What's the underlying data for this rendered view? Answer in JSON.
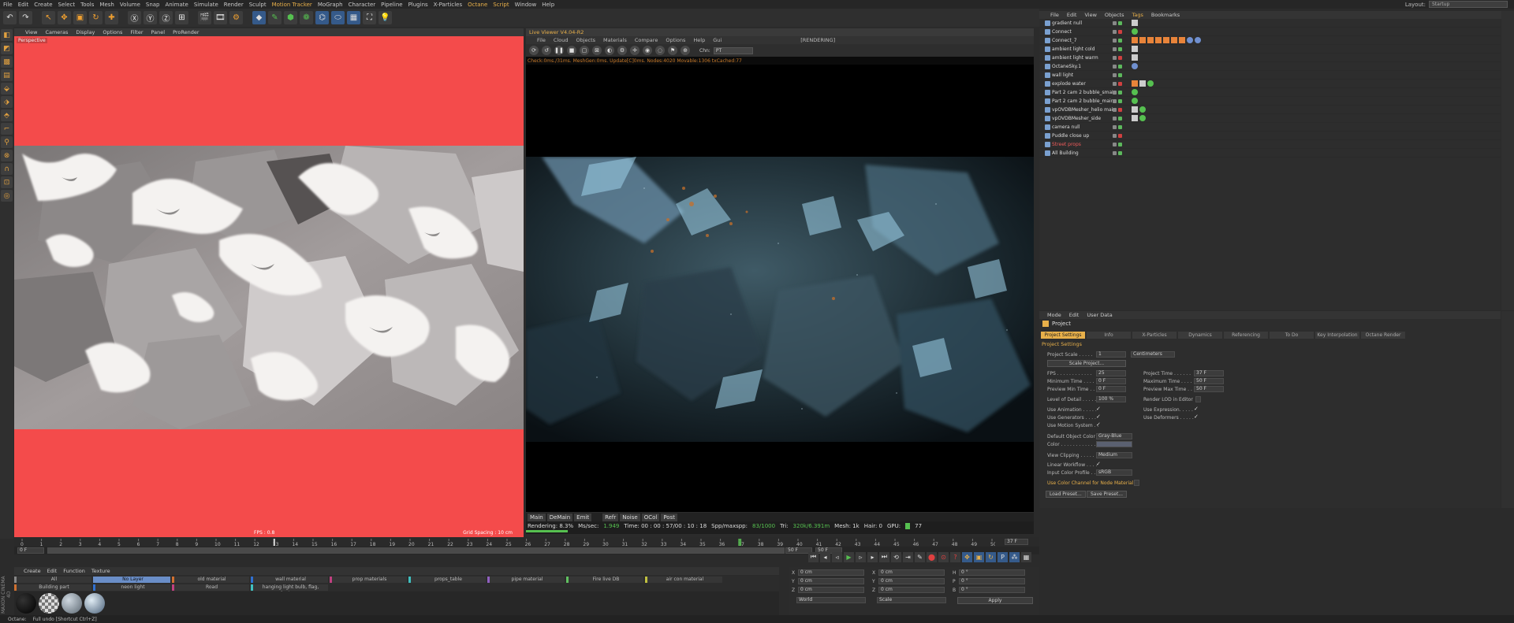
{
  "menubar": [
    "File",
    "Edit",
    "Create",
    "Select",
    "Tools",
    "Mesh",
    "Volume",
    "Snap",
    "Animate",
    "Simulate",
    "Render",
    "Sculpt",
    "Motion Tracker",
    "MoGraph",
    "Character",
    "Pipeline",
    "Plugins",
    "X-Particles",
    "Octane",
    "Script",
    "Window",
    "Help"
  ],
  "layout": {
    "label": "Layout:",
    "value": "Startup"
  },
  "viewport": {
    "menu": [
      "View",
      "Cameras",
      "Display",
      "Options",
      "Filter",
      "Panel",
      "ProRender"
    ],
    "label": "Perspective",
    "fps": "FPS : 0.8",
    "grid": "Grid Spacing : 10 cm"
  },
  "live_viewer": {
    "title": "Live Viewer V4.04-R2",
    "menu": [
      "File",
      "Cloud",
      "Objects",
      "Materials",
      "Compare",
      "Options",
      "Help",
      "Gui"
    ],
    "rendering_label": "[RENDERING]",
    "channel_label": "Chn:",
    "channel_value": "PT",
    "status": "Check:0ms./31ms. MeshGen:0ms. Update[C]0ms. Nodes:4020 Movable:1306 txCached:77",
    "tabs": [
      "Main",
      "DeMain",
      "Emit",
      "Refr",
      "Noise",
      "OCol",
      "Post"
    ],
    "stats": {
      "rendering": "Rendering: 8.3%",
      "ms_label": "Ms/sec:",
      "ms_value": "1.949",
      "time": "Time: 00 : 00 : 57/00 : 10 : 18",
      "spp_label": "Spp/maxspp:",
      "spp_value": "83/1000",
      "tri_label": "Tri:",
      "tri_value": "320k/6.391m",
      "mesh": "Mesh: 1k",
      "hair": "Hair: 0",
      "gpu_label": "GPU:",
      "gpu_value": "77"
    },
    "progress": 0.083
  },
  "object_manager": {
    "menu": [
      "File",
      "Edit",
      "View",
      "Objects",
      "Tags",
      "Bookmarks"
    ],
    "objects": [
      {
        "name": "gradient null",
        "red": false
      },
      {
        "name": "Connect",
        "red": false
      },
      {
        "name": "Connect_7",
        "red": false
      },
      {
        "name": "ambient light cold",
        "red": false
      },
      {
        "name": "ambient light warm",
        "red": false
      },
      {
        "name": "OctaneSky.1",
        "red": false
      },
      {
        "name": "wall light",
        "red": false
      },
      {
        "name": "explode water",
        "red": false
      },
      {
        "name": "Part 2 cam 2 bubble_small.2",
        "red": false
      },
      {
        "name": "Part 2 cam 2 bubble_main.2",
        "red": false
      },
      {
        "name": "vpOVDBMesher_helio main",
        "red": false
      },
      {
        "name": "vpOVDBMesher_side",
        "red": false
      },
      {
        "name": "camera null",
        "red": false
      },
      {
        "name": "Puddle close up",
        "red": false
      },
      {
        "name": "Street props",
        "red": true
      },
      {
        "name": "All Building",
        "red": false
      }
    ]
  },
  "attribute_manager": {
    "menu": [
      "Mode",
      "Edit",
      "User Data"
    ],
    "title": "Project",
    "tabs": [
      "Project Settings",
      "Info",
      "X-Particles",
      "Dynamics",
      "Referencing",
      "To Do",
      "Key Interpolation",
      "Octane Render"
    ],
    "section": "Project Settings",
    "project_scale_label": "Project Scale . . . . .",
    "project_scale_value": "1",
    "project_scale_unit": "Centimeters",
    "scale_project_button": "Scale Project...",
    "fps_label": "FPS . . . . . . . . . . . .",
    "fps_value": "25",
    "project_time_label": "Project Time . . . . . .",
    "project_time_value": "37 F",
    "min_time_label": "Minimum Time . . . .",
    "min_time_value": "0 F",
    "max_time_label": "Maximum Time . . . .",
    "max_time_value": "50 F",
    "prev_min_label": "Preview Min Time . .",
    "prev_min_value": "0 F",
    "prev_max_label": "Preview Max Time . .",
    "prev_max_value": "50 F",
    "lod_label": "Level of Detail . . . . .",
    "lod_value": "100 %",
    "render_lod_label": "Render LOD in Editor",
    "use_animation": "Use Animation . . . . .",
    "use_expression": "Use Expression. . . . .",
    "use_generators": "Use Generators . . . .",
    "use_deformers": "Use Deformers . . . . .",
    "use_motion": "Use Motion System . .",
    "default_color_label": "Default Object Color",
    "default_color_value": "Gray-Blue",
    "color_label": "Color . . . . . . . . . . . .",
    "view_clipping_label": "View Clipping . . . . .",
    "view_clipping_value": "Medium",
    "linear_label": "Linear Workflow . . . .",
    "input_color_label": "Input Color Profile . .",
    "input_color_value": "sRGB",
    "use_color_channel": "Use Color Channel for Node Material",
    "load_preset": "Load Preset...",
    "save_preset": "Save Preset...",
    "checkmark": "✓"
  },
  "timeline": {
    "frames": [
      "0",
      "1",
      "2",
      "3",
      "4",
      "5",
      "6",
      "7",
      "8",
      "9",
      "10",
      "11",
      "12",
      "13",
      "14",
      "15",
      "16",
      "17",
      "18",
      "19",
      "20",
      "21",
      "22",
      "23",
      "24",
      "25",
      "26",
      "27",
      "28",
      "29",
      "30",
      "31",
      "32",
      "33",
      "34",
      "35",
      "36",
      "37",
      "38",
      "39",
      "40",
      "41",
      "42",
      "43",
      "44",
      "45",
      "46",
      "47",
      "48",
      "49",
      "50"
    ],
    "current_frame": "37 F",
    "start_field": "0 F",
    "end_field_a": "50 F",
    "end_field_b": "50 F"
  },
  "material_manager": {
    "menu": [
      "Create",
      "Edit",
      "Function",
      "Texture"
    ],
    "layers_row1": [
      "All",
      "No Layer",
      "old material",
      "wall material",
      "prop materials",
      "props_table",
      "pipe material",
      "Fire live DB",
      "air con material"
    ],
    "layers_row2": [
      "Building part",
      "neon light",
      "Road",
      "hanging light bulb, flag, lanterns"
    ]
  },
  "coordinates": {
    "labels": [
      "X",
      "Y",
      "Z",
      "X",
      "Y",
      "Z",
      "H",
      "P",
      "B"
    ],
    "values": [
      "0 cm",
      "0 cm",
      "0 cm",
      "0 cm",
      "0 cm",
      "0 cm",
      "0 °",
      "0 °",
      "0 °"
    ],
    "world": "World",
    "scale": "Scale",
    "apply": "Apply"
  },
  "status": {
    "left": "Octane:",
    "message": "Full undo [Shortcut Ctrl+Z]"
  },
  "brand": "MAXON CINEMA 4D"
}
